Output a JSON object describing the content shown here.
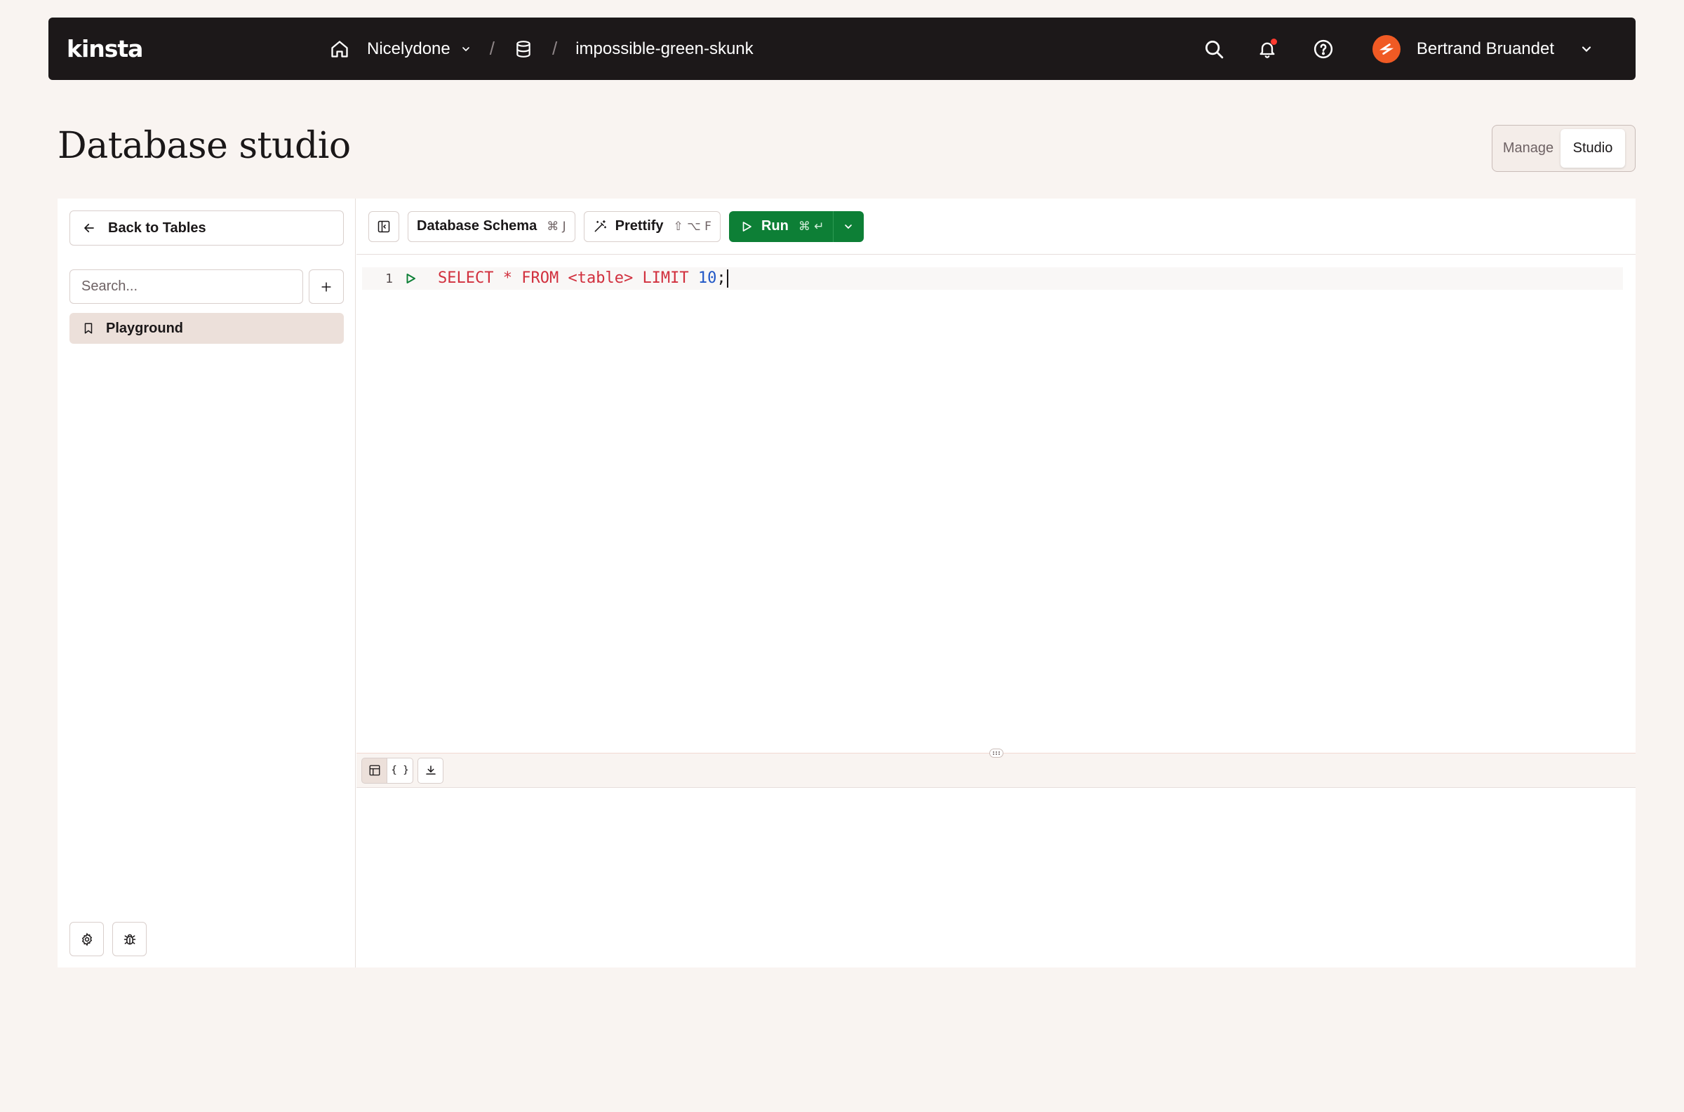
{
  "app": {
    "logo_text": "kinsta"
  },
  "header": {
    "company": "Nicelydone",
    "separator": "/",
    "database_name": "impossible-green-skunk",
    "user_name": "Bertrand Bruandet",
    "icons": [
      "home-icon",
      "chevron-down-icon",
      "database-icon",
      "search-icon",
      "bell-icon",
      "help-icon",
      "avatar",
      "chevron-down-icon"
    ]
  },
  "page": {
    "title": "Database studio"
  },
  "mode_toggle": {
    "manage_label": "Manage",
    "studio_label": "Studio",
    "selected": "Studio"
  },
  "sidebar": {
    "back_label": "Back to Tables",
    "search_placeholder": "Search...",
    "items": [
      {
        "label": "Playground",
        "icon": "bookmark-icon",
        "selected": true
      }
    ]
  },
  "toolbar": {
    "schema_label": "Database Schema",
    "schema_shortcut": "⌘ J",
    "prettify_label": "Prettify",
    "prettify_shortcut": "⇧ ⌥ F",
    "run_label": "Run",
    "run_shortcut": "⌘ ↵"
  },
  "editor": {
    "line_number": "1",
    "tokens": {
      "select": "SELECT",
      "star": "*",
      "from": "FROM",
      "table": "<table>",
      "limit": "LIMIT",
      "number": "10",
      "semicolon": ";"
    }
  },
  "results": {
    "view_table_label": "table",
    "view_json_label": "{ }"
  },
  "colors": {
    "topbar": "#1c1819",
    "background": "#f9f4f1",
    "run_green": "#0d7f36",
    "keyword_red": "#d12f3d",
    "number_blue": "#1f56c6",
    "selected_item": "#ece0da",
    "avatar_orange": "#f05a24"
  }
}
